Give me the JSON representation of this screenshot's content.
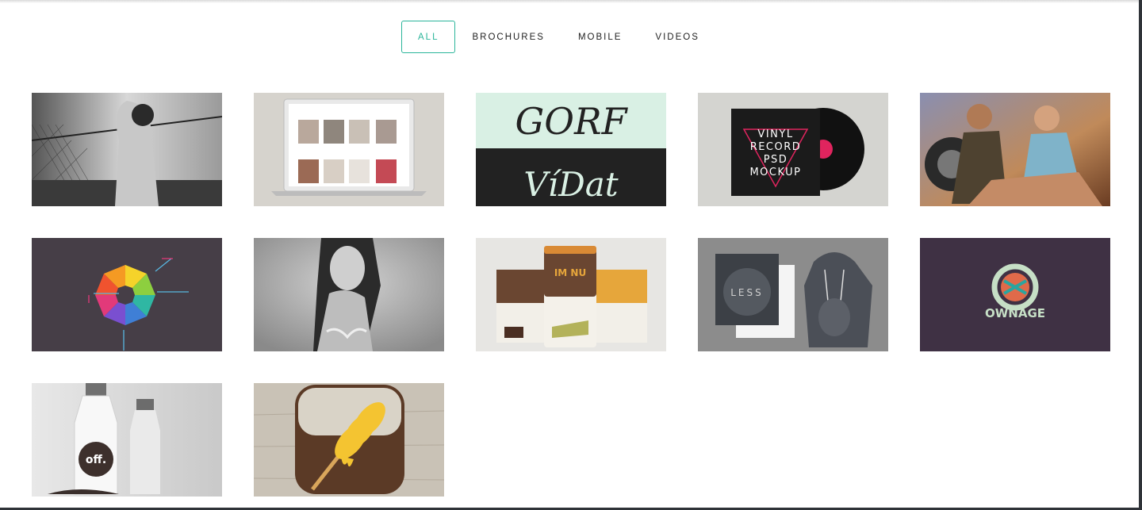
{
  "filters": [
    {
      "label": "ALL",
      "active": true
    },
    {
      "label": "BROCHURES",
      "active": false
    },
    {
      "label": "MOBILE",
      "active": false
    },
    {
      "label": "VIDEOS",
      "active": false
    }
  ],
  "portfolio": {
    "items": [
      {
        "name": "fashion-photo"
      },
      {
        "name": "laptop-website-mockup"
      },
      {
        "name": "calligraphy-artwork",
        "text_top": "GORF",
        "text_bottom": "VíDat"
      },
      {
        "name": "vinyl-record-mockup",
        "lines": [
          "VINYL",
          "RECORD",
          "PSD",
          "MOCKUP"
        ]
      },
      {
        "name": "couple-motorcycle-photo"
      },
      {
        "name": "colorful-logo"
      },
      {
        "name": "portrait-photo"
      },
      {
        "name": "packaging-mockup",
        "brand": "IM NU"
      },
      {
        "name": "apparel-mockup",
        "brand": "LESS"
      },
      {
        "name": "ownage-logo",
        "brand": "OWNAGE"
      },
      {
        "name": "bottle-mockup",
        "brand": "off."
      },
      {
        "name": "honey-app-icon"
      }
    ]
  },
  "colors": {
    "accent": "#2bb59a",
    "text": "#222222",
    "dark_tile": "#3f3b42"
  }
}
